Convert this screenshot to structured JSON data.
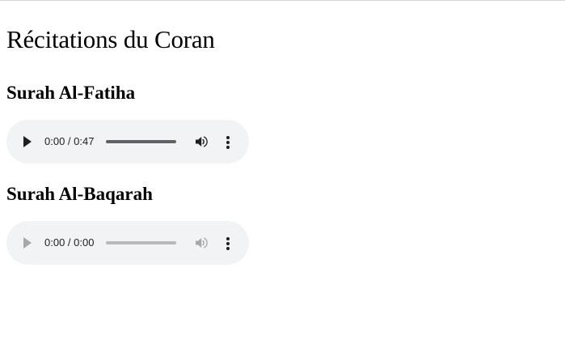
{
  "page": {
    "title": "Récitations du Coran"
  },
  "sections": [
    {
      "title": "Surah Al-Fatiha",
      "player": {
        "current_time": "0:00",
        "duration": "0:47",
        "time_display": "0:00 / 0:47",
        "progress_fraction": 0,
        "enabled": true
      }
    },
    {
      "title": "Surah Al-Baqarah",
      "player": {
        "current_time": "0:00",
        "duration": "0:00",
        "time_display": "0:00 / 0:00",
        "progress_fraction": 0,
        "enabled": false
      }
    }
  ],
  "icons": {
    "play": "play-icon",
    "volume": "volume-icon",
    "menu": "more-vertical-icon"
  },
  "colors": {
    "player_background": "#f1f3f4",
    "control_active": "#1f1f1f",
    "control_disabled": "#a8a8a8"
  }
}
